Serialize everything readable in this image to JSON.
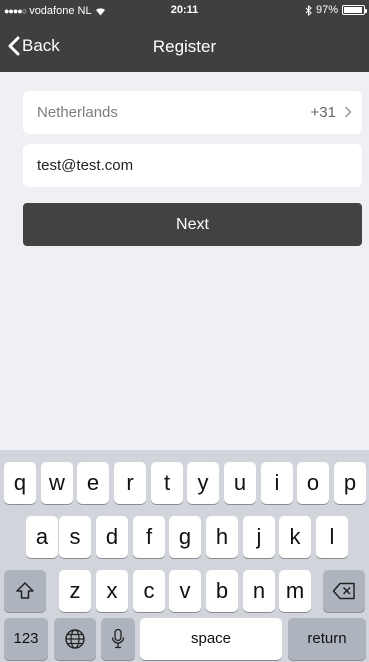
{
  "status_bar": {
    "signal_dots": "●●●●○",
    "carrier": "vodafone NL",
    "time": "20:11",
    "battery": "97%"
  },
  "navbar": {
    "back_label": "Back",
    "title": "Register"
  },
  "form": {
    "country_name": "Netherlands",
    "country_code": "+31",
    "email_value": "test@test.com",
    "next_label": "Next"
  },
  "keyboard": {
    "row1": [
      "q",
      "w",
      "e",
      "r",
      "t",
      "y",
      "u",
      "i",
      "o",
      "p"
    ],
    "row2": [
      "a",
      "s",
      "d",
      "f",
      "g",
      "h",
      "j",
      "k",
      "l"
    ],
    "row3": [
      "z",
      "x",
      "c",
      "v",
      "b",
      "n",
      "m"
    ],
    "numbers_label": "123",
    "space_label": "space",
    "return_label": "return"
  },
  "colors": {
    "header_bg": "#3f3f3f",
    "page_bg": "#efeff4",
    "button_bg": "#424242",
    "keyboard_bg": "#d1d5db"
  }
}
